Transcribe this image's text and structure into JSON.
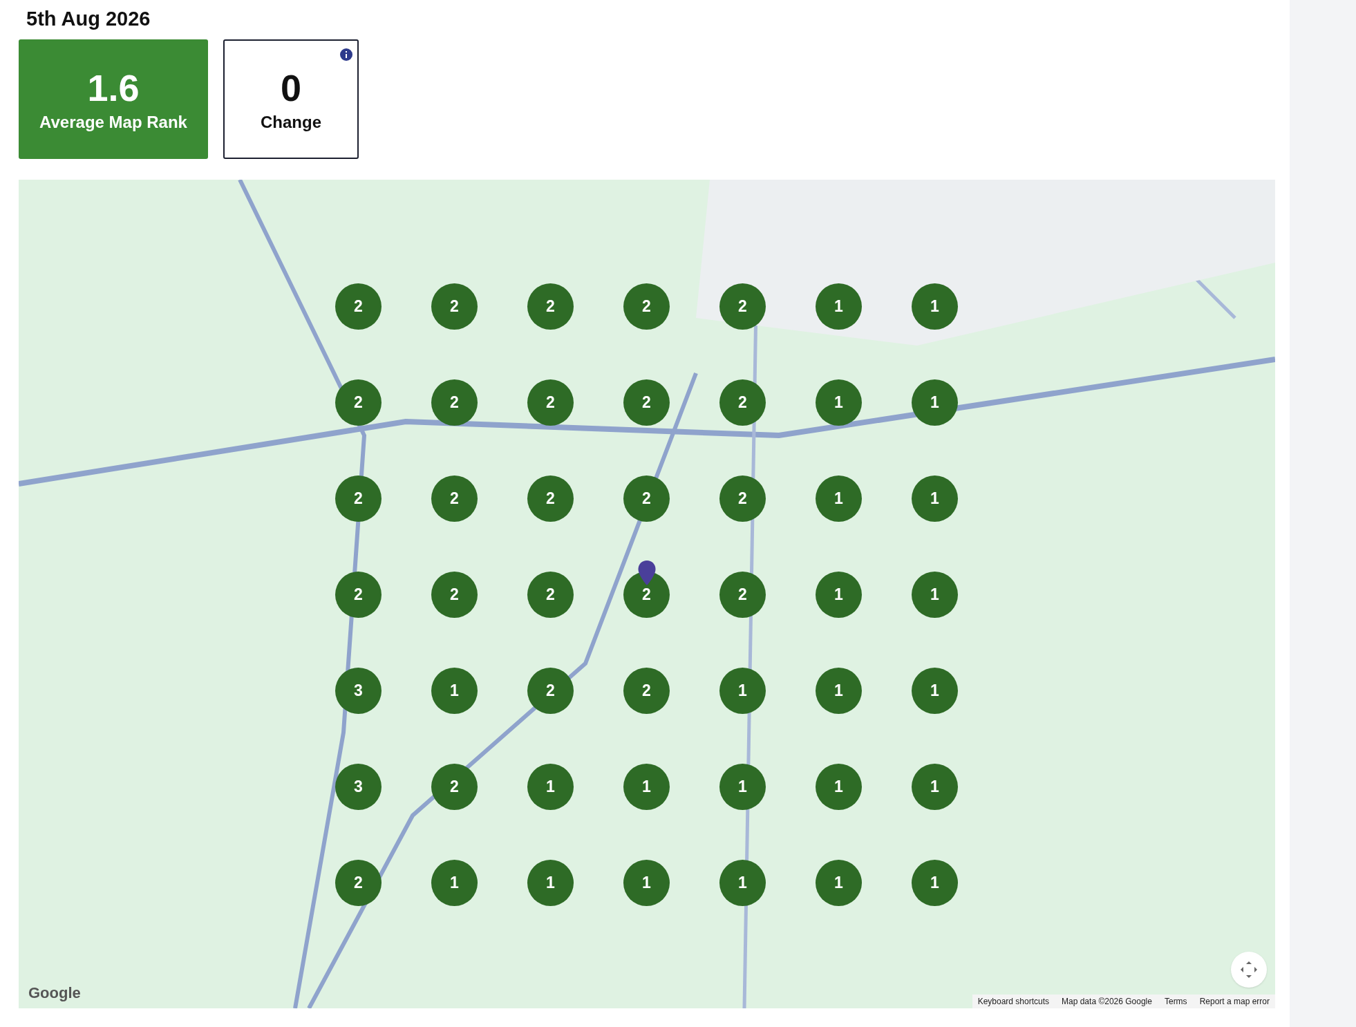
{
  "date": "5th Aug 2026",
  "stats": [
    {
      "kind": "highlight",
      "value": "1.6",
      "label": "Average Map Rank",
      "info": false
    },
    {
      "kind": "plain",
      "value": "0",
      "label": "Change",
      "info": true
    }
  ],
  "map": {
    "rank_grid": [
      [
        "2",
        "2",
        "2",
        "2",
        "2",
        "1",
        "1"
      ],
      [
        "2",
        "2",
        "2",
        "2",
        "2",
        "1",
        "1"
      ],
      [
        "2",
        "2",
        "2",
        "2",
        "2",
        "1",
        "1"
      ],
      [
        "2",
        "2",
        "2",
        "2",
        "2",
        "1",
        "1"
      ],
      [
        "3",
        "1",
        "2",
        "2",
        "1",
        "1",
        "1"
      ],
      [
        "3",
        "2",
        "1",
        "1",
        "1",
        "1",
        "1"
      ],
      [
        "2",
        "1",
        "1",
        "1",
        "1",
        "1",
        "1"
      ]
    ],
    "logo": "Google",
    "footer_links": [
      "Keyboard shortcuts",
      "Map data ©2026 Google",
      "Terms",
      "Report a map error"
    ]
  }
}
